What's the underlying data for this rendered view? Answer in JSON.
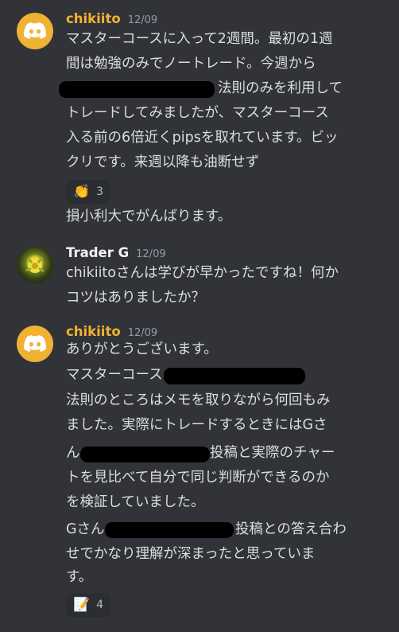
{
  "messages": [
    {
      "author": "chikiito",
      "time": "12/09",
      "lines": [
        "マスターコースに入って2週間。最初の1週",
        "間は勉強のみでノートレード。今週から",
        "法則のみを利用して",
        "トレードしてみましたが、マスターコース",
        "入る前の6倍近くpipsを取れています。ビッ",
        "クリです。来週以降も油断せず"
      ],
      "reaction": {
        "emoji": "👏",
        "count": "3"
      },
      "after_reaction": "損小利大でがんばります。"
    },
    {
      "author": "Trader G",
      "time": "12/09",
      "lines": [
        "chikiitoさんは学びが早かったですね！何か",
        "コツはありましたか？"
      ]
    },
    {
      "author": "chikiito",
      "time": "12/09",
      "lines": [
        "ありがとうございます。",
        "マスターコース",
        "法則のところはメモを取りながら何回もみ",
        "ました。実際にトレードするときにはGさ",
        "ん",
        "投稿と実際のチャー",
        "トを見比べて自分で同じ判断ができるのか",
        "を検証していました。",
        "Gさん",
        "投稿との答え合わ",
        "せでかなり理解が深まったと思っていま",
        "す。"
      ],
      "reaction": {
        "emoji": "📝",
        "count": "4"
      }
    }
  ],
  "colors": {
    "background": "#313338",
    "author_highlight": "#f0b232",
    "text": "#dbdee1",
    "timestamp": "#949ba4"
  },
  "icons": [
    "discord-logo-icon",
    "trader-g-avatar"
  ]
}
